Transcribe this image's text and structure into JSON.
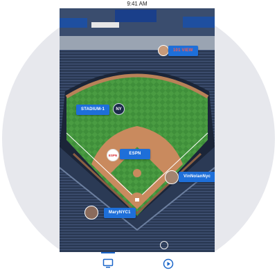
{
  "status_bar": {
    "time": "9:41 AM"
  },
  "stadium": {
    "pins": [
      {
        "label": "101 VIEW",
        "style": "red"
      },
      {
        "label": "STADIUM-1",
        "style": "blue"
      },
      {
        "label": "ESPN",
        "style": "blue"
      },
      {
        "label": "VinNolanNyc",
        "style": "blue"
      },
      {
        "label": "MaryNYC1",
        "style": "blue"
      }
    ],
    "logos": {
      "team": "NY",
      "network": "ESPN"
    }
  },
  "bottom_nav": {
    "tabs": [
      {
        "icon": "tv-icon",
        "active": true
      },
      {
        "icon": "play-icon",
        "active": false
      }
    ],
    "accent": "#1a66c9"
  },
  "colors": {
    "pin": "#1e6fd9",
    "pin_alert_text": "#ff5a4a",
    "grass": "#3f8f3a",
    "dirt": "#c98a5e"
  }
}
